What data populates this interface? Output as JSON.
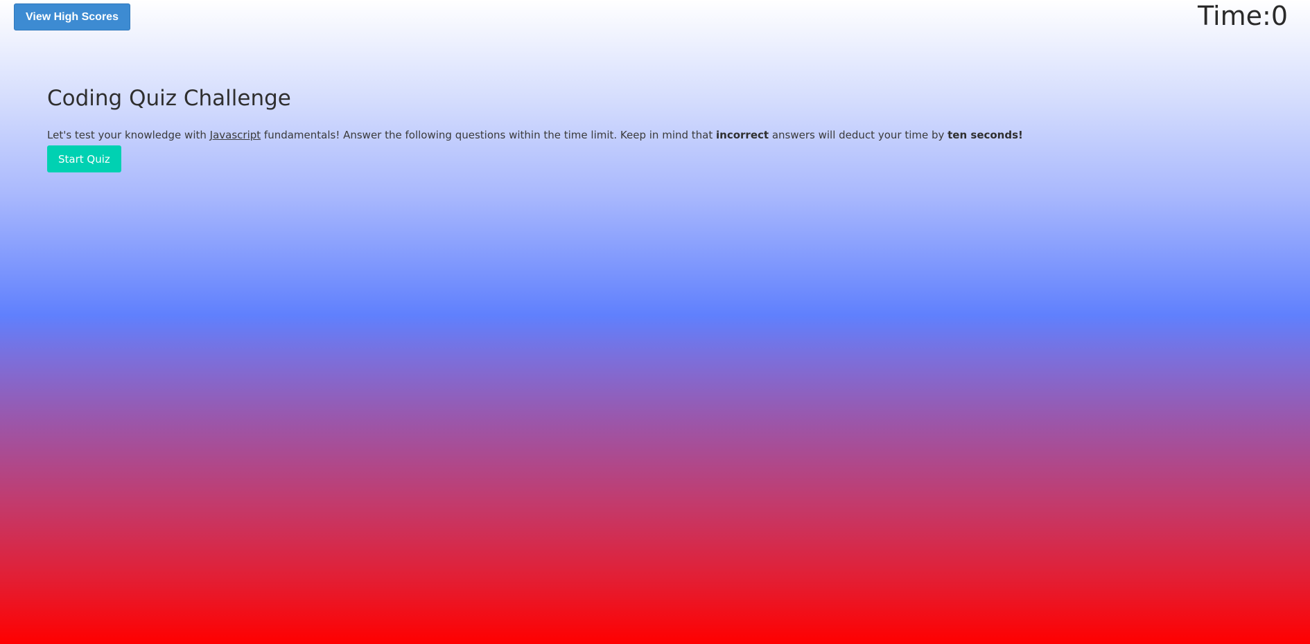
{
  "header": {
    "high_scores_label": "View High Scores",
    "timer_label": "Time:",
    "timer_value": "0"
  },
  "intro": {
    "title": "Coding Quiz Challenge",
    "text_part1": "Let's test your knowledge with ",
    "link_text": "Javascript",
    "text_part2": " fundamentals! Answer the following questions within the time limit. Keep in mind that ",
    "bold1": "incorrect",
    "text_part3": " answers will deduct your time by ",
    "bold2": "ten seconds!",
    "start_label": "Start Quiz"
  },
  "colors": {
    "high_scores_button": "#3d8bd2",
    "start_button": "#00d1b2",
    "gradient_top": "#ffffff",
    "gradient_middle": "#6080fd",
    "gradient_bottom": "#ff0000"
  }
}
